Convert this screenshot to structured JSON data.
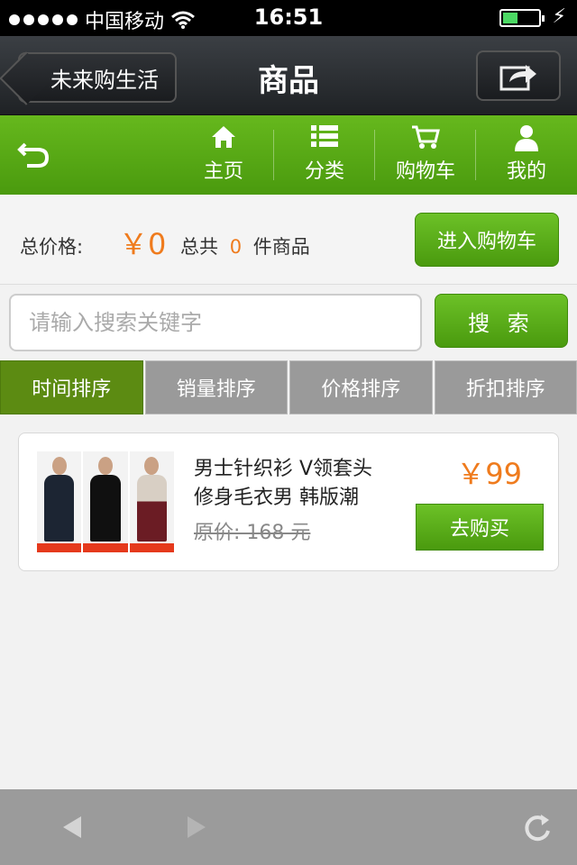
{
  "status_bar": {
    "carrier": "中国移动",
    "time": "16:51"
  },
  "title_bar": {
    "back_label": "未来购生活",
    "title": "商品"
  },
  "nav": {
    "items": [
      {
        "label": "主页",
        "icon": "home-icon"
      },
      {
        "label": "分类",
        "icon": "list-icon"
      },
      {
        "label": "购物车",
        "icon": "cart-icon"
      },
      {
        "label": "我的",
        "icon": "user-icon"
      }
    ]
  },
  "summary": {
    "total_label": "总价格:",
    "total_price": "￥0",
    "count_prefix": "总共",
    "count": "0",
    "count_suffix": "件商品",
    "cart_button": "进入购物车"
  },
  "search": {
    "placeholder": "请输入搜索关键字",
    "button": "搜 索"
  },
  "sort_tabs": [
    {
      "label": "时间排序",
      "active": true
    },
    {
      "label": "销量排序",
      "active": false
    },
    {
      "label": "价格排序",
      "active": false
    },
    {
      "label": "折扣排序",
      "active": false
    }
  ],
  "products": [
    {
      "name": "男士针织衫 V领套头修身毛衣男 韩版潮",
      "original_price": "原价: 168 元",
      "price": "￥99",
      "buy_label": "去购买"
    }
  ],
  "colors": {
    "accent_green": "#5aa914",
    "price_orange": "#ef7b1d",
    "dark_bar": "#2a2d31",
    "toolbar_gray": "#9b9b9b"
  }
}
